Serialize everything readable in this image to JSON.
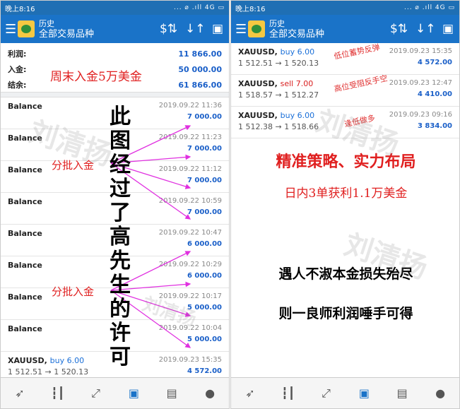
{
  "status": {
    "time": "晚上8:16",
    "icons": "... ⌀ .ıll 4G ▭"
  },
  "appbar": {
    "title": "历史",
    "subtitle": "全部交易品种"
  },
  "summary": [
    {
      "label": "利润:",
      "value": "11 866.00"
    },
    {
      "label": "入金:",
      "value": "50 000.00"
    },
    {
      "label": "结余:",
      "value": "61 866.00"
    }
  ],
  "deposit_note": "周末入金5万美金",
  "balance_rows": [
    {
      "name": "Balance",
      "date": "2019.09.22 11:36",
      "amount": "7 000.00"
    },
    {
      "name": "Balance",
      "date": "2019.09.22 11:23",
      "amount": "7 000.00"
    },
    {
      "name": "Balance",
      "date": "2019.09.22 11:12",
      "amount": "7 000.00"
    },
    {
      "name": "Balance",
      "date": "2019.09.22 10:59",
      "amount": "7 000.00"
    },
    {
      "name": "Balance",
      "date": "2019.09.22 10:47",
      "amount": "6 000.00"
    },
    {
      "name": "Balance",
      "date": "2019.09.22 10:29",
      "amount": "6 000.00"
    },
    {
      "name": "Balance",
      "date": "2019.09.22 10:17",
      "amount": "5 000.00"
    },
    {
      "name": "Balance",
      "date": "2019.09.22 10:04",
      "amount": "5 000.00"
    }
  ],
  "left_last_trade": {
    "symbol": "XAUUSD,",
    "type": "buy 6.00",
    "price": "1 512.51 → 1 520.13",
    "date": "2019.09.23 15:35",
    "amount": "4 572.00"
  },
  "batch_label_1": "分批入金",
  "batch_label_2": "分批入金",
  "vertical_text": [
    "此",
    "图",
    "经",
    "过",
    "了",
    "高",
    "先",
    "生",
    "的",
    "许",
    "可"
  ],
  "trades": [
    {
      "symbol": "XAUUSD,",
      "type": "buy 6.00",
      "kind": "buy",
      "price": "1 512.51 → 1 520.13",
      "date": "2019.09.23 15:35",
      "amount": "4 572.00",
      "note": "低位蓄势反弹"
    },
    {
      "symbol": "XAUUSD,",
      "type": "sell 7.00",
      "kind": "sell",
      "price": "1 518.57 → 1 512.27",
      "date": "2019.09.23 12:47",
      "amount": "4 410.00",
      "note": "高位受阻反手空"
    },
    {
      "symbol": "XAUUSD,",
      "type": "buy 6.00",
      "kind": "buy",
      "price": "1 512.38 → 1 518.66",
      "date": "2019.09.23 09:16",
      "amount": "3 834.00",
      "note": "逢低做多"
    }
  ],
  "promo": {
    "headline": "精准策略、实力布局",
    "subline": "日内3单获利1.1万美金",
    "line1": "遇人不淑本金损失殆尽",
    "line2": "则一良师利润唾手可得"
  },
  "watermark": "刘清扬",
  "colors": {
    "accent": "#1a73c8",
    "profit": "#1a5fc8",
    "annotation": "#e02020",
    "arrow": "#e030e0"
  },
  "nav_icons": [
    "chart-arrow-icon",
    "candlestick-icon",
    "trend-icon",
    "inbox-icon",
    "news-icon",
    "chat-icon"
  ]
}
